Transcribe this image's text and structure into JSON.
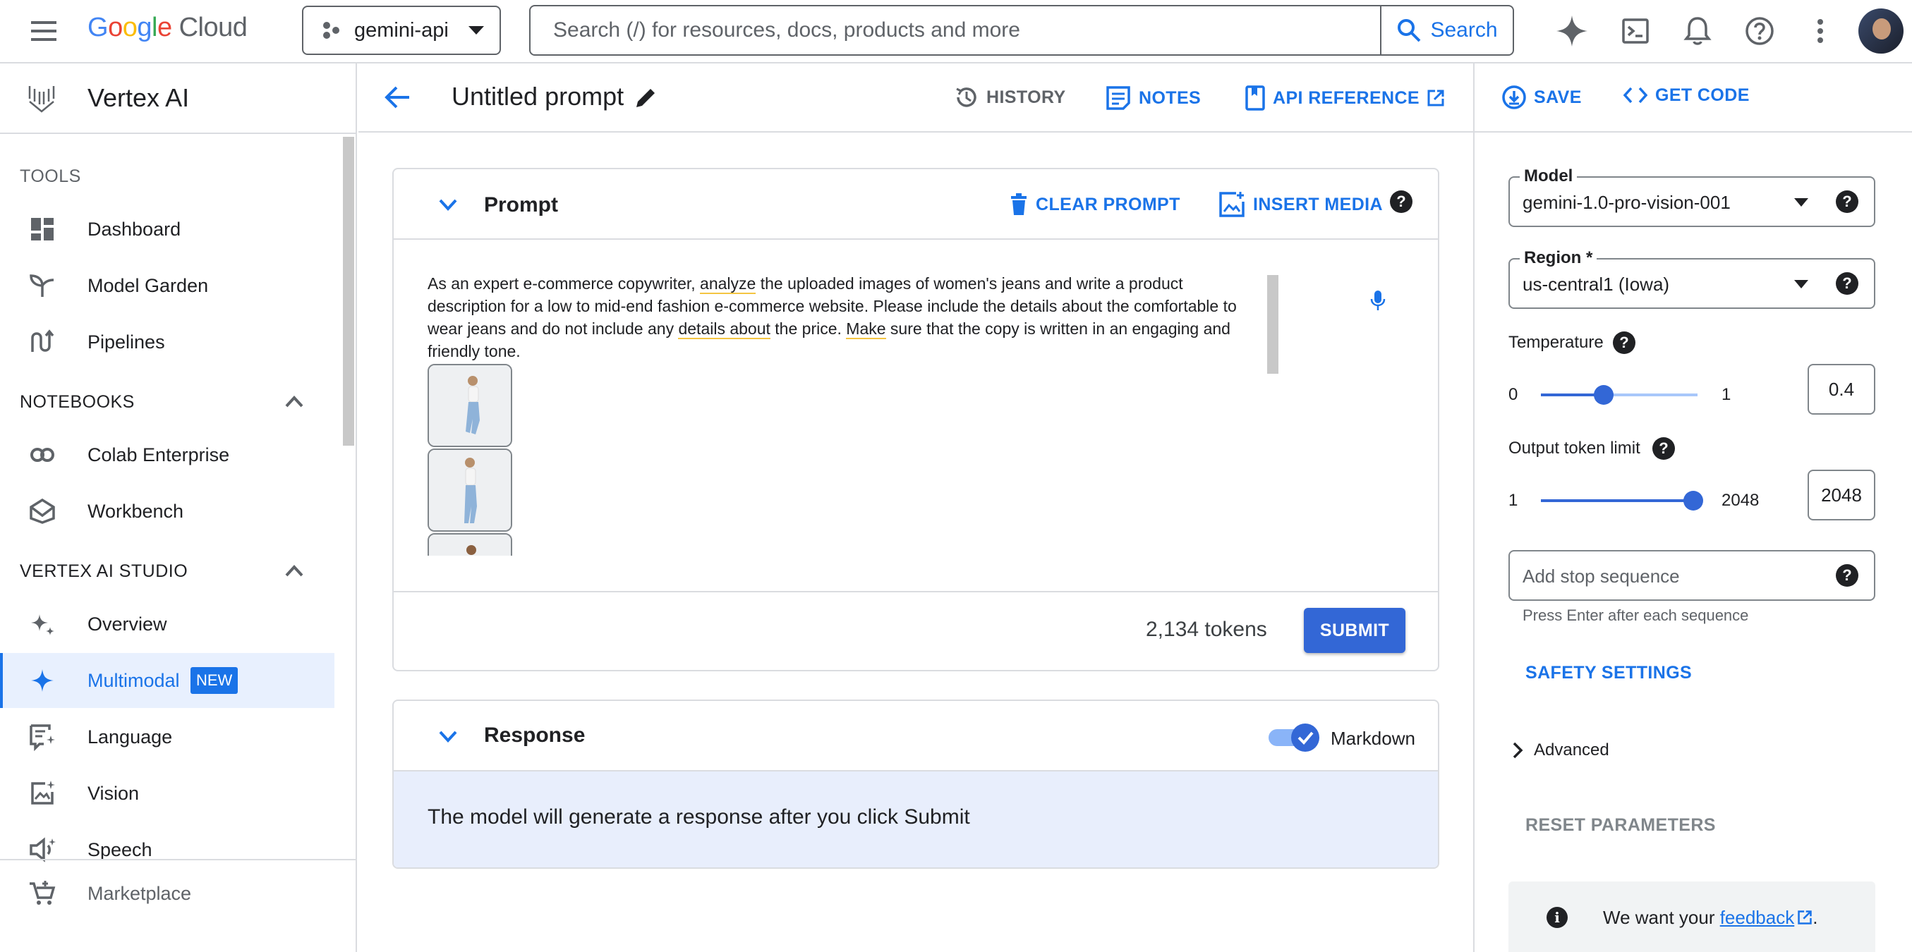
{
  "topbar": {
    "brand_google": "Google",
    "brand_cloud": "Cloud",
    "project": "gemini-api",
    "search_placeholder": "Search (/) for resources, docs, products and more",
    "search_button": "Search"
  },
  "product": {
    "name": "Vertex AI"
  },
  "sidebar": {
    "tools_header": "TOOLS",
    "tools": [
      {
        "label": "Dashboard",
        "icon": "dashboard-icon"
      },
      {
        "label": "Model Garden",
        "icon": "model-garden-icon"
      },
      {
        "label": "Pipelines",
        "icon": "pipelines-icon"
      }
    ],
    "notebooks_header": "NOTEBOOKS",
    "notebooks": [
      {
        "label": "Colab Enterprise",
        "icon": "colab-icon"
      },
      {
        "label": "Workbench",
        "icon": "workbench-icon"
      }
    ],
    "studio_header": "VERTEX AI STUDIO",
    "studio": [
      {
        "label": "Overview",
        "icon": "sparkle-overview-icon"
      },
      {
        "label": "Multimodal",
        "icon": "sparkle-icon",
        "badge": "NEW",
        "selected": true
      },
      {
        "label": "Language",
        "icon": "language-icon"
      },
      {
        "label": "Vision",
        "icon": "vision-icon"
      },
      {
        "label": "Speech",
        "icon": "speech-icon"
      }
    ],
    "marketplace": "Marketplace"
  },
  "prompt_header": {
    "title": "Untitled prompt",
    "history": "HISTORY",
    "notes": "NOTES",
    "api_reference": "API REFERENCE",
    "save": "SAVE",
    "get_code": "GET CODE"
  },
  "prompt_card": {
    "title": "Prompt",
    "clear": "CLEAR PROMPT",
    "insert_media": "INSERT MEDIA",
    "text_parts": [
      "As an expert e-commerce copywriter, ",
      "analyze",
      " the uploaded images of women's jeans and write a product description for a low to mid-end fashion e-commerce website. Please include the details about the comfortable to wear jeans and do not include any ",
      "details about",
      " the price. ",
      "Make",
      " sure that the copy is written in an engaging and friendly tone."
    ],
    "tokens": "2,134 tokens",
    "submit": "SUBMIT"
  },
  "response_card": {
    "title": "Response",
    "markdown_label": "Markdown",
    "markdown_enabled": true,
    "placeholder": "The model will generate a response after you click Submit"
  },
  "params": {
    "model_label": "Model",
    "model_value": "gemini-1.0-pro-vision-001",
    "region_label": "Region *",
    "region_value": "us-central1 (Iowa)",
    "temperature_label": "Temperature",
    "temperature_min": "0",
    "temperature_max": "1",
    "temperature_value": "0.4",
    "temperature_fraction": 0.4,
    "token_label": "Output token limit",
    "token_min": "1",
    "token_max": "2048",
    "token_value": "2048",
    "token_fraction": 1.0,
    "stop_placeholder": "Add stop sequence",
    "stop_hint": "Press Enter after each sequence",
    "safety": "SAFETY SETTINGS",
    "advanced": "Advanced",
    "reset": "RESET PARAMETERS",
    "feedback_prefix": "We want your ",
    "feedback_link": "feedback",
    "feedback_suffix": "."
  },
  "colors": {
    "accent": "#1a73e8",
    "selected_bg": "#e8f0fe",
    "submit_bg": "#3367d6",
    "response_bg": "#e8eefc"
  }
}
